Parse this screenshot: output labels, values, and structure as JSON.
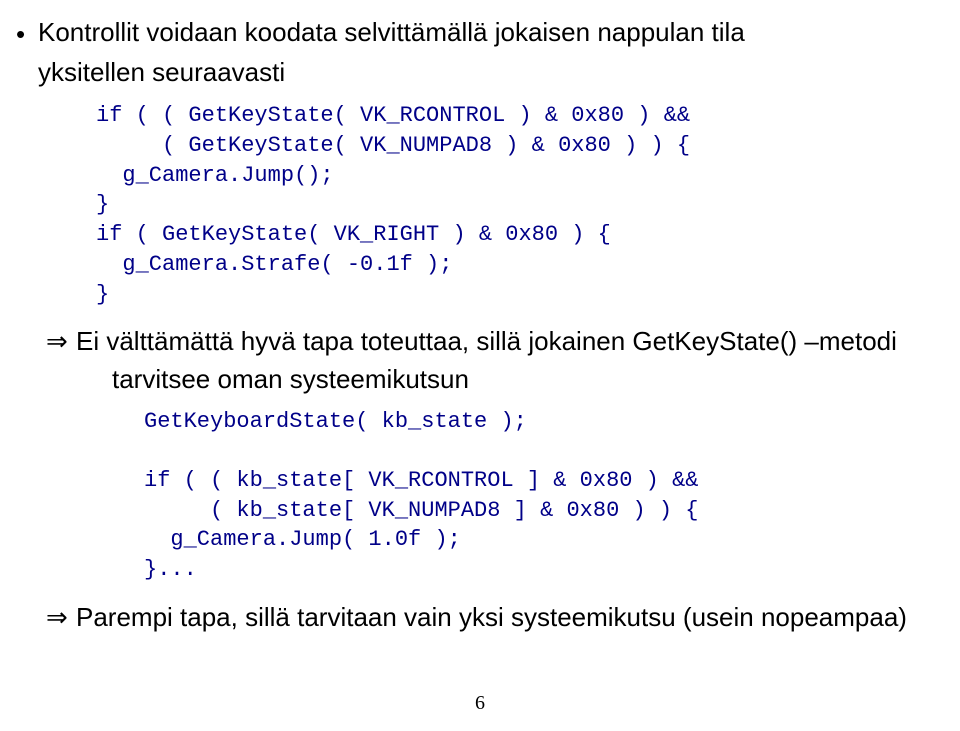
{
  "bullet1_line1": "Kontrollit voidaan koodata selvittämällä jokaisen nappulan tila",
  "bullet1_line2": "yksitellen seuraavasti",
  "code1": "if ( ( GetKeyState( VK_RCONTROL ) & 0x80 ) &&\n     ( GetKeyState( VK_NUMPAD8 ) & 0x80 ) ) {\n  g_Camera.Jump();\n}\nif ( GetKeyState( VK_RIGHT ) & 0x80 ) {\n  g_Camera.Strafe( -0.1f );\n}",
  "arrow1_line1": "Ei välttämättä hyvä tapa toteuttaa, sillä jokainen GetKeyState() –metodi",
  "arrow1_line2": "tarvitsee oman systeemikutsun",
  "code2": "GetKeyboardState( kb_state );\n\nif ( ( kb_state[ VK_RCONTROL ] & 0x80 ) &&\n     ( kb_state[ VK_NUMPAD8 ] & 0x80 ) ) {\n  g_Camera.Jump( 1.0f );\n}...",
  "arrow2_line1": "Parempi tapa, sillä tarvitaan vain yksi systeemikutsu (usein nopeampaa)",
  "bullet_glyph": "•",
  "arrow_glyph": "⇒",
  "page_number": "6"
}
